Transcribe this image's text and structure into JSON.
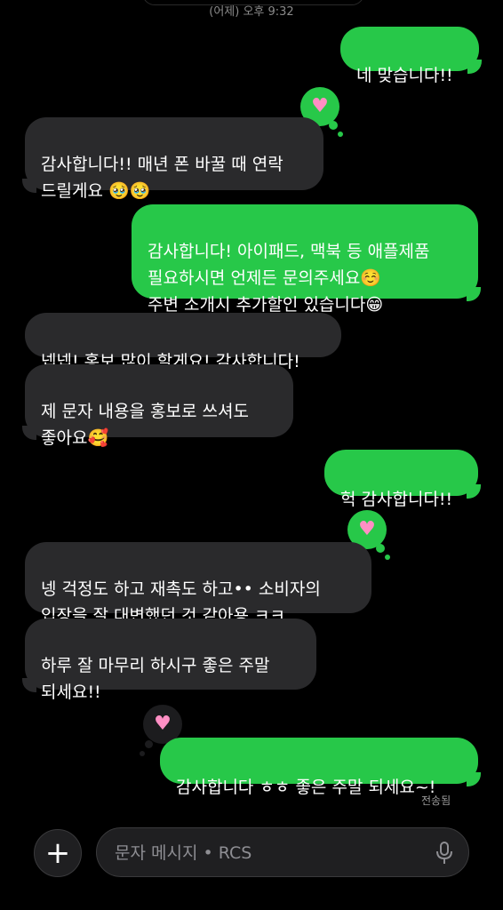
{
  "header": {
    "timestamp": "(어제) 오후 9:32"
  },
  "messages": [
    {
      "id": "m1",
      "side": "out",
      "text": "네 맞습니다!!"
    },
    {
      "id": "m2",
      "side": "in",
      "text": "감사합니다!! 매년 폰 바꿀 때 연락\n드릴게요 🥹🥹",
      "reaction": "heart"
    },
    {
      "id": "m3",
      "side": "out",
      "text": "감사합니다! 아이패드, 맥북 등 애플제품\n필요하시면 언제든 문의주세요☺️\n주변 소개시 추가할인 있습니다😁"
    },
    {
      "id": "m4",
      "side": "in",
      "text": "넵넵! 홍보 많이 할게요! 감사합니다!"
    },
    {
      "id": "m5",
      "side": "in",
      "text": "제 문자 내용을 홍보로 쓰셔도\n좋아요🥰"
    },
    {
      "id": "m6",
      "side": "out",
      "text": "헉 감사합니다!!"
    },
    {
      "id": "m7",
      "side": "in",
      "text": "넹 걱정도 하고 재촉도 하고•• 소비자의\n입장을 잘 대변했던 것 같아용 ㅋㅋ",
      "reaction": "heart"
    },
    {
      "id": "m8",
      "side": "in",
      "text": "하루 잘 마무리 하시구 좋은 주말\n되세요!!"
    },
    {
      "id": "m9",
      "side": "out",
      "text": "감사합니다 ㅎㅎ 좋은 주말 되세요~!",
      "reaction": "heart"
    }
  ],
  "reaction_icon": "heart-icon",
  "status": {
    "sent": "전송됨"
  },
  "composer": {
    "placeholder": "문자 메시지 • RCS",
    "add_icon": "plus-icon",
    "mic_icon": "microphone-icon"
  },
  "colors": {
    "outgoing": "#27c849",
    "incoming": "#2a2a2c",
    "background": "#000000",
    "reaction_heart": "#ff8fc4"
  }
}
